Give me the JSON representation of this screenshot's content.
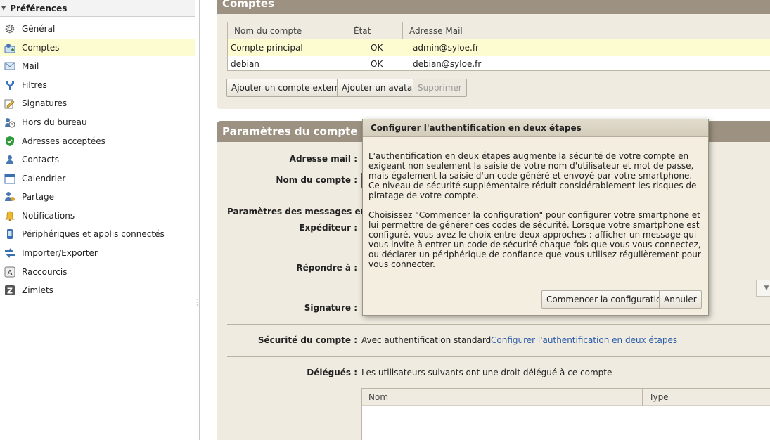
{
  "sidebar": {
    "title": "Préférences",
    "items": [
      {
        "label": "Général",
        "icon": "gear-icon"
      },
      {
        "label": "Comptes",
        "icon": "accounts-icon"
      },
      {
        "label": "Mail",
        "icon": "mail-icon"
      },
      {
        "label": "Filtres",
        "icon": "filter-icon"
      },
      {
        "label": "Signatures",
        "icon": "signature-icon"
      },
      {
        "label": "Hors du bureau",
        "icon": "out-of-office-icon"
      },
      {
        "label": "Adresses acceptées",
        "icon": "shield-check-icon"
      },
      {
        "label": "Contacts",
        "icon": "contact-icon"
      },
      {
        "label": "Calendrier",
        "icon": "calendar-icon"
      },
      {
        "label": "Partage",
        "icon": "share-icon"
      },
      {
        "label": "Notifications",
        "icon": "bell-icon"
      },
      {
        "label": "Périphériques et applis connectés",
        "icon": "device-icon"
      },
      {
        "label": "Importer/Exporter",
        "icon": "import-export-icon"
      },
      {
        "label": "Raccourcis",
        "icon": "keyboard-icon"
      },
      {
        "label": "Zimlets",
        "icon": "zimlet-icon"
      }
    ]
  },
  "accounts": {
    "panel_title": "Comptes",
    "columns": [
      "Nom du compte",
      "État",
      "Adresse Mail"
    ],
    "rows": [
      {
        "name": "Compte principal",
        "state": "OK",
        "email": "admin@syloe.fr"
      },
      {
        "name": "debian",
        "state": "OK",
        "email": "debian@syloe.fr"
      }
    ],
    "buttons": {
      "add_external": "Ajouter un compte externe",
      "add_avatar": "Ajouter un avatar",
      "delete": "Supprimer"
    }
  },
  "params": {
    "panel_title": "Paramètres du compte pri",
    "email_label": "Adresse mail :",
    "account_name_label": "Nom du compte :",
    "sent_section": "Paramètres des messages envoyé",
    "sender_label": "Expéditeur :",
    "reply_label": "Répondre à :",
    "signature_label": "Signature :",
    "security_label": "Sécurité du compte :",
    "security_value": "Avec authentification standard",
    "security_link": "Configurer l'authentification en deux étapes",
    "delegates_label": "Délégués :",
    "delegates_value": "Les utilisateurs suivants ont une droit délégué à ce compte",
    "delegates_columns": [
      "Nom",
      "Type"
    ]
  },
  "dialog": {
    "title": "Configurer l'authentification en deux étapes",
    "paragraph1": "L'authentification en deux étapes augmente la sécurité de votre compte en exigeant non seulement la saisie de votre nom d'utilisateur et mot de passe, mais également la saisie d'un code généré et envoyé par votre smartphone. Ce niveau de sécurité supplémentaire réduit considérablement les risques de piratage de votre compte.",
    "paragraph2": "Choisissez \"Commencer la configuration\" pour configurer votre smartphone et lui permettre de générer ces codes de sécurité. Lorsque votre smartphone est configuré, vous avez le choix entre deux approches : afficher un message qui vous invite à entrer un code de sécurité chaque fois que vous vous connectez, ou déclarer un périphérique de confiance que vous utilisez régulièrement pour vous connecter.",
    "start_button": "Commencer la configuration",
    "cancel_button": "Annuler"
  }
}
